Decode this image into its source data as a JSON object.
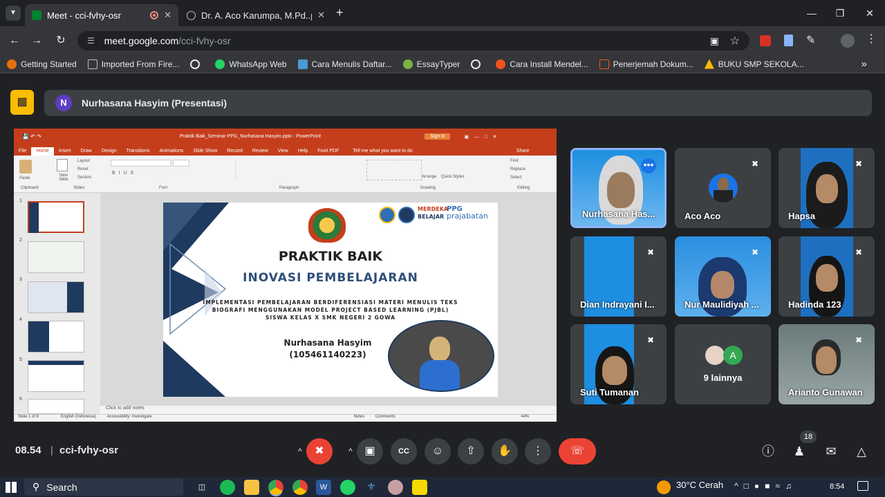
{
  "browser": {
    "tabs": [
      {
        "title": "Meet - cci-fvhy-osr"
      },
      {
        "title": "Dr. A. Aco Karumpa, M.Pd..pdf"
      }
    ],
    "url_host": "meet.google.com",
    "url_path": "/cci-fvhy-osr",
    "bookmarks": [
      {
        "label": "Getting Started"
      },
      {
        "label": "Imported From Fire..."
      },
      {
        "label": "WhatsApp Web"
      },
      {
        "label": "Cara Menulis Daftar..."
      },
      {
        "label": "EssayTyper"
      },
      {
        "label": "Cara Install Mendel..."
      },
      {
        "label": "Penerjemah Dokum..."
      },
      {
        "label": "BUKU SMP SEKOLA..."
      }
    ]
  },
  "meet": {
    "presenter_initial": "N",
    "presenter_label": "Nurhasana Hasyim (Presentasi)",
    "time": "08.54",
    "meeting_code": "cci-fvhy-osr",
    "participant_count": "18",
    "participants": [
      {
        "name": "Nurhasana Has..."
      },
      {
        "name": "Aco Aco"
      },
      {
        "name": "Hapsa"
      },
      {
        "name": "Dian Indrayani I..."
      },
      {
        "name": "Nur Maulidiyah ..."
      },
      {
        "name": "Hadinda 123"
      },
      {
        "name": "Suti Tumanan"
      },
      {
        "name": "9 lainnya"
      },
      {
        "name": "Arianto Gunawan"
      }
    ],
    "others_initial": "A"
  },
  "ppt": {
    "window_title": "Praktik Baik_Seminar PPG_Nurhasana Hasyim.pptx - PowerPoint",
    "sign_in": "Sign in",
    "menu": [
      "File",
      "Home",
      "Insert",
      "Draw",
      "Design",
      "Transitions",
      "Animations",
      "Slide Show",
      "Record",
      "Review",
      "View",
      "Help",
      "Foxit PDF"
    ],
    "tell_me": "Tell me what you want to do",
    "share": "Share",
    "ribbon_groups": [
      "Clipboard",
      "Slides",
      "Font",
      "Paragraph",
      "Drawing",
      "Editing"
    ],
    "ribbon_items": {
      "paste": "Paste",
      "new_slide": "New Slide",
      "layout": "Layout",
      "reset": "Reset",
      "section": "Section",
      "find": "Find",
      "replace": "Replace",
      "select": "Select",
      "arrange": "Arrange",
      "quick_styles": "Quick Styles"
    },
    "thumb_numbers": [
      "1",
      "2",
      "3",
      "4",
      "5",
      "6"
    ],
    "notes_placeholder": "Click to add notes",
    "status_left": "Slide 1 of 8",
    "status_lang": "English (Indonesia)",
    "status_access": "Accessibility: Investigate",
    "status_notes": "Notes",
    "status_comments": "Comments",
    "zoom": "44%",
    "slide": {
      "title": "PRAKTIK BAIK",
      "subtitle": "INOVASI PEMBELAJARAN",
      "desc1": "IMPLEMENTASI PEMBELAJARAN BERDIFERENSIASI MATERI MENULIS TEKS",
      "desc2": "BIOGRAFI MENGGUNAKAN MODEL PROJECT BASED LEARNING (PJBL)",
      "desc3": "SISWA KELAS X SMK NEGERI 2 GOWA",
      "author": "Nurhasana Hasyim",
      "nim": "(105461140223)",
      "logo_merdeka": "MERDEKA",
      "logo_belajar": "BELAJAR",
      "logo_ppg": "PPG",
      "logo_prajabatan": "prajabatan"
    }
  },
  "taskbar": {
    "search": "Search",
    "weather": "30°C  Cerah",
    "time": "8:54"
  },
  "colors": {
    "ppt_red": "#c43e1c",
    "leave_red": "#ea4335",
    "present_yellow": "#fbbc04",
    "slide_navy": "#1f3a5f"
  }
}
